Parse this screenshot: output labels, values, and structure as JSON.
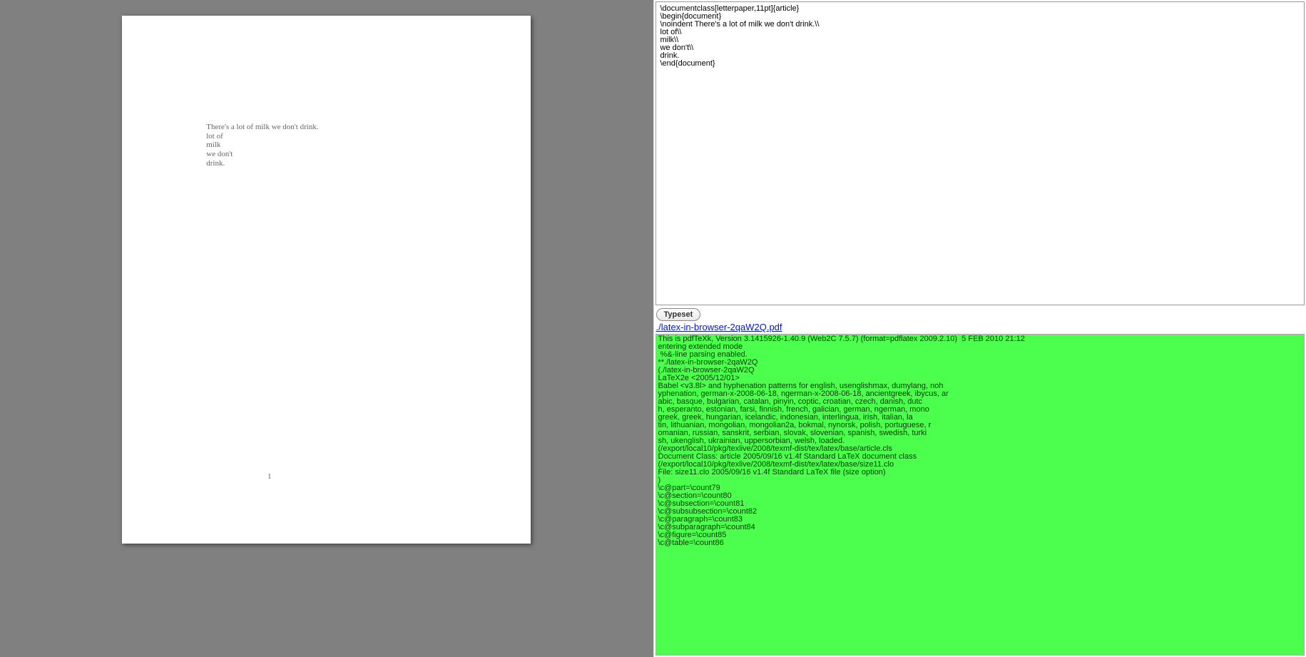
{
  "preview": {
    "lines": [
      "There's a lot of milk we don't drink.",
      "lot of",
      "milk",
      "we don't",
      "drink."
    ],
    "page_number": "1"
  },
  "source": "\\documentclass[letterpaper,11pt]{article}\n\\begin{document}\n\\noindent There's a lot of milk we don't drink.\\\\\nlot of\\\\\nmilk\\\\\nwe don't\\\\\ndrink.\n\\end{document}",
  "controls": {
    "typeset_label": "Typeset",
    "pdf_link_text": "./latex-in-browser-2qaW2Q.pdf"
  },
  "log": "This is pdfTeXk, Version 3.1415926-1.40.9 (Web2C 7.5.7) (format=pdflatex 2009.2.10)  5 FEB 2010 21:12\nentering extended mode\n %&-line parsing enabled.\n**./latex-in-browser-2qaW2Q\n(./latex-in-browser-2qaW2Q\nLaTeX2e <2005/12/01>\nBabel <v3.8l> and hyphenation patterns for english, usenglishmax, dumylang, noh\nyphenation, german-x-2008-06-18, ngerman-x-2008-06-18, ancientgreek, ibycus, ar\nabic, basque, bulgarian, catalan, pinyin, coptic, croatian, czech, danish, dutc\nh, esperanto, estonian, farsi, finnish, french, galician, german, ngerman, mono\ngreek, greek, hungarian, icelandic, indonesian, interlingua, irish, italian, la\ntin, lithuanian, mongolian, mongolian2a, bokmal, nynorsk, polish, portuguese, r\nomanian, russian, sanskrit, serbian, slovak, slovenian, spanish, swedish, turki\nsh, ukenglish, ukrainian, uppersorbian, welsh, loaded.\n(/export/local10/pkg/texlive/2008/texmf-dist/tex/latex/base/article.cls\nDocument Class: article 2005/09/16 v1.4f Standard LaTeX document class\n(/export/local10/pkg/texlive/2008/texmf-dist/tex/latex/base/size11.clo\nFile: size11.clo 2005/09/16 v1.4f Standard LaTeX file (size option)\n)\n\\c@part=\\count79\n\\c@section=\\count80\n\\c@subsection=\\count81\n\\c@subsubsection=\\count82\n\\c@paragraph=\\count83\n\\c@subparagraph=\\count84\n\\c@figure=\\count85\n\\c@table=\\count86\n"
}
